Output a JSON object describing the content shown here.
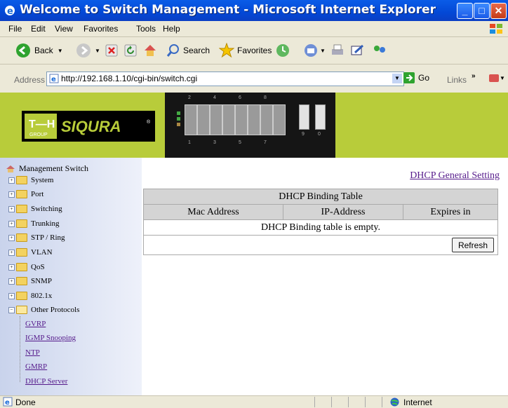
{
  "window": {
    "title": "Welcome to Switch Management - Microsoft Internet Explorer"
  },
  "menu": [
    "File",
    "Edit",
    "View",
    "Favorites",
    "Tools",
    "Help"
  ],
  "toolbar": {
    "back": "Back",
    "search": "Search",
    "favorites": "Favorites"
  },
  "address": {
    "label": "Address",
    "url": "http://192.168.1.10/cgi-bin/switch.cgi",
    "go": "Go",
    "links": "Links"
  },
  "banner": {
    "logo_left": "T—H",
    "logo_sub": "GROUP",
    "logo_brand": "SIQURA",
    "port_numbers": [
      "2",
      "4",
      "6",
      "8",
      "1",
      "3",
      "5",
      "7",
      "9",
      "0"
    ]
  },
  "sidebar": {
    "root": "Management Switch",
    "items": [
      "System",
      "Port",
      "Switching",
      "Trunking",
      "STP / Ring",
      "VLAN",
      "QoS",
      "SNMP",
      "802.1x",
      "Other Protocols"
    ],
    "sub_items": [
      "GVRP",
      "IGMP Snooping",
      "NTP",
      "GMRP",
      "DHCP Server"
    ]
  },
  "main": {
    "link": "DHCP General Setting",
    "table_title": "DHCP Binding Table",
    "columns": [
      "Mac Address",
      "IP-Address",
      "Expires in"
    ],
    "empty_message": "DHCP Binding table is empty.",
    "refresh": "Refresh"
  },
  "status": {
    "left": "Done",
    "zone": "Internet"
  }
}
